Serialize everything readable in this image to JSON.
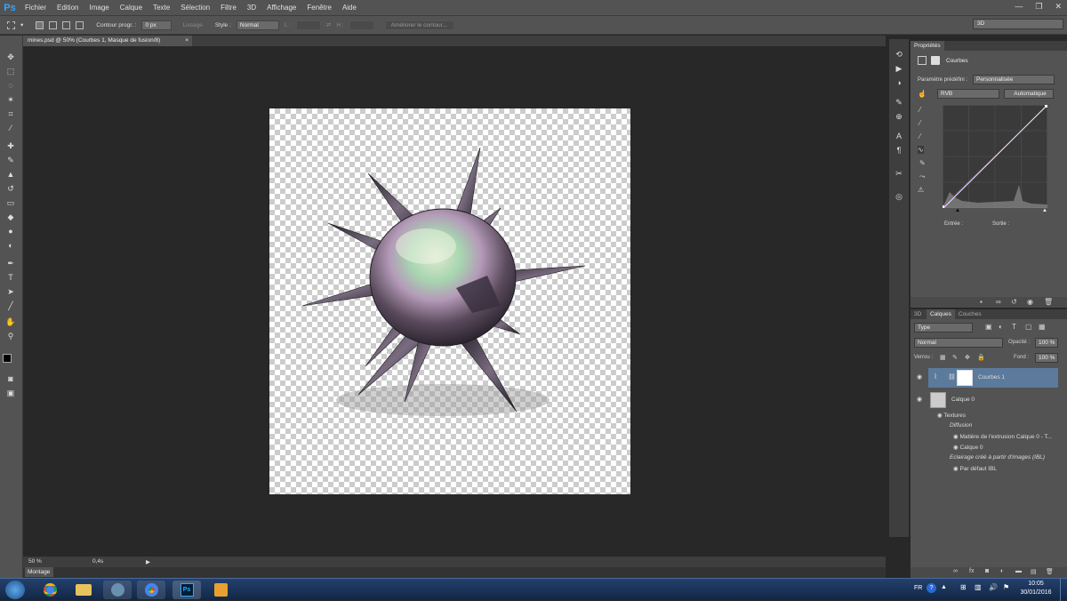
{
  "app": {
    "logo": "Ps"
  },
  "menu": [
    "Fichier",
    "Edition",
    "Image",
    "Calque",
    "Texte",
    "Sélection",
    "Filtre",
    "3D",
    "Affichage",
    "Fenêtre",
    "Aide"
  ],
  "window_controls": {
    "minimize": "—",
    "restore": "❐",
    "close": "✕"
  },
  "options": {
    "feather_label": "Contour progr. :",
    "feather_value": "0 px",
    "antialias_label": "Lissage",
    "style_label": "Style :",
    "style_value": "Normal",
    "width_label": "L :",
    "height_label": "H :",
    "refine_label": "Améliorer le contour..."
  },
  "workspace": "3D",
  "document": {
    "tab_title": "mines.psd @ 50% (Courbes 1, Masque de fusion/8)",
    "close": "×"
  },
  "status": {
    "zoom": "50 %",
    "info": "0,4s"
  },
  "montage": "Montage",
  "properties": {
    "tab": "Propriétés",
    "adjustment": "Courbes",
    "preset_label": "Paramètre prédéfini :",
    "preset_value": "Personnalisée",
    "channel": "RVB",
    "auto_label": "Automatique",
    "input_label": "Entrée :",
    "output_label": "Sortie :"
  },
  "layers": {
    "tabs": [
      "3D",
      "Calques",
      "Couches"
    ],
    "filter": "Type",
    "blend_mode": "Normal",
    "opacity_label": "Opacité :",
    "opacity_value": "100 %",
    "lock_label": "Verrou :",
    "fill_label": "Fond :",
    "fill_value": "100 %",
    "items": [
      {
        "name": "Courbes 1"
      },
      {
        "name": "Calque 0"
      },
      {
        "name": "Textures"
      },
      {
        "name": "Diffusion"
      },
      {
        "name": "Matière de l'extrusion Calque 0 - T..."
      },
      {
        "name": "Calque 0"
      },
      {
        "name": "Eclairage créé à partir d'images (IBL)"
      },
      {
        "name": "Par défaut IBL"
      }
    ]
  },
  "taskbar": {
    "lang": "FR",
    "time": "10:05",
    "date": "30/01/2016"
  },
  "colors": {
    "panel": "#535353",
    "dark": "#282828",
    "selected_layer": "#5b7a9c",
    "ps_blue": "#31a8ff"
  }
}
